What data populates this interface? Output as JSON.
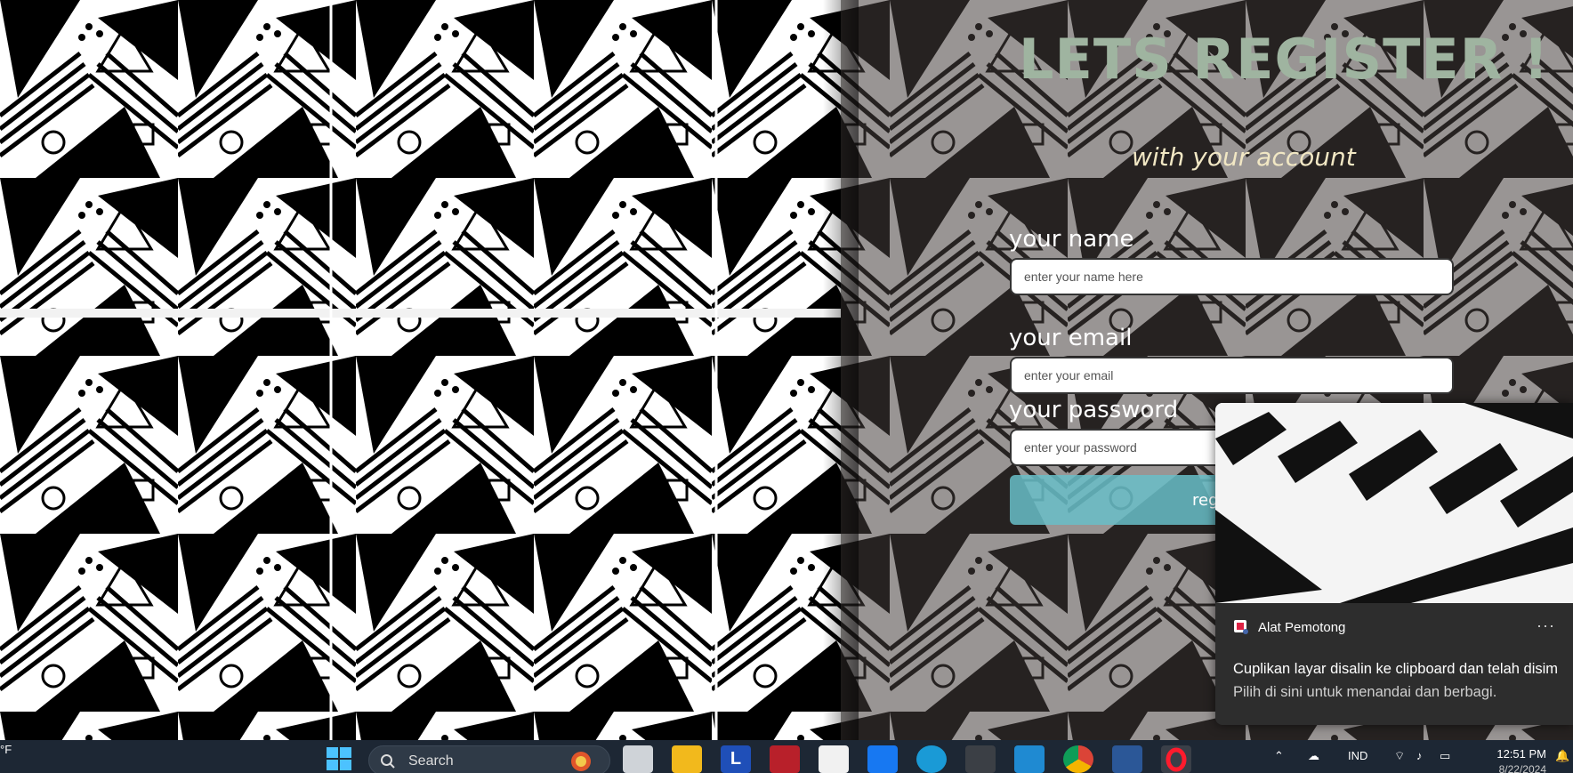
{
  "form": {
    "title": "LETS REGISTER !",
    "subtitle": "with your account",
    "name_label": "your name",
    "name_placeholder": "enter your name here",
    "email_label": "your email",
    "email_placeholder": "enter your email",
    "password_label": "your password",
    "password_placeholder": "enter your password",
    "register_label": "reg"
  },
  "toast": {
    "app_name": "Alat Pemotong",
    "more": "···",
    "message": "Cuplikan layar disalin ke clipboard dan telah disim",
    "sub": "Pilih di sini untuk menandai dan berbagi."
  },
  "taskbar": {
    "weather_temp": "°F",
    "search_label": "Search",
    "language": "IND",
    "time": "12:51 PM",
    "date": "8/22/2024"
  },
  "colors": {
    "title": "#9fb4a0",
    "subtitle": "#f1e7c4",
    "register_button": "#69bec8",
    "taskbar": "#1d2734"
  },
  "icons": [
    "windows-start-icon",
    "search-icon",
    "file-explorer-icon",
    "folder-icon",
    "l-app-icon",
    "mail-icon",
    "store-icon",
    "dropbox-icon",
    "edge-icon",
    "terminal-icon",
    "vscode-icon",
    "chrome-icon",
    "word-icon",
    "opera-icon"
  ]
}
